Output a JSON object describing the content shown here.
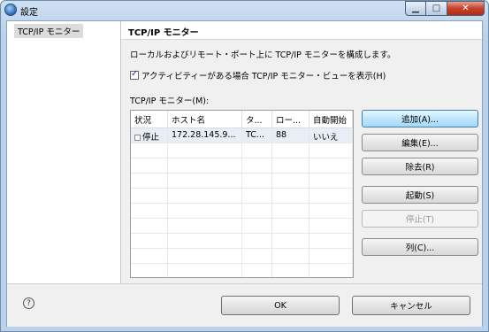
{
  "window": {
    "title": "設定"
  },
  "nav": {
    "items": [
      {
        "label": "TCP/IP モニター"
      }
    ]
  },
  "page": {
    "title": "TCP/IP モニター",
    "description": "ローカルおよびリモート・ポート上に TCP/IP モニターを構成します。",
    "checkbox_label": "アクティビティーがある場合 TCP/IP モニター・ビューを表示(H)",
    "checkbox_checked": true,
    "list_label": "TCP/IP モニター(M):"
  },
  "table": {
    "columns": [
      "状況",
      "ホスト名",
      "タ...",
      "ロー...",
      "自動開始"
    ],
    "rows": [
      {
        "status": "停止",
        "host": "172.28.145.9...",
        "type": "TC...",
        "port": "88",
        "autostart": "いいえ"
      }
    ]
  },
  "buttons": {
    "add": "追加(A)...",
    "edit": "編集(E)...",
    "remove": "除去(R)",
    "start": "起動(S)",
    "stop": "停止(T)",
    "columns": "列(C)..."
  },
  "footer": {
    "ok": "OK",
    "cancel": "キャンセル",
    "help": "?"
  },
  "colors": {
    "title_bg": "#b9d1ea",
    "close_button": "#c5412b",
    "primary_button": "#bee6fd"
  }
}
